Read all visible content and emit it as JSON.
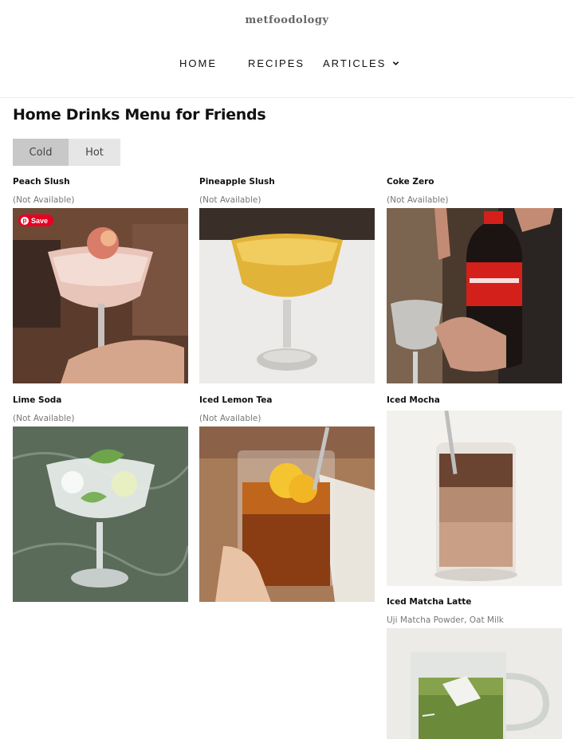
{
  "site": {
    "logo": "metfoodology",
    "nav": [
      {
        "label": "HOME"
      },
      {
        "label": "RECIPES"
      },
      {
        "label": "ARTICLES"
      }
    ]
  },
  "page": {
    "title": "Home Drinks Menu for Friends",
    "tabs": [
      {
        "label": "Cold",
        "active": true
      },
      {
        "label": "Hot",
        "active": false
      }
    ]
  },
  "pin_save_label": "Save",
  "drinks": [
    {
      "name": "Peach Slush",
      "note": "(Not Available)"
    },
    {
      "name": "Pineapple Slush",
      "note": "(Not Available)"
    },
    {
      "name": "Coke Zero",
      "note": "(Not Available)"
    },
    {
      "name": "Lime Soda",
      "note": "(Not Available)"
    },
    {
      "name": "Iced Lemon Tea",
      "note": "(Not Available)"
    },
    {
      "name": "Iced Mocha",
      "note": ""
    },
    {
      "name": "Iced Matcha Latte",
      "note": "Uji Matcha Powder, Oat Milk"
    }
  ],
  "colors": {
    "tab_active": "#c8c8c8",
    "tab_inactive": "#e6e6e6",
    "pin_red": "#e60023"
  }
}
